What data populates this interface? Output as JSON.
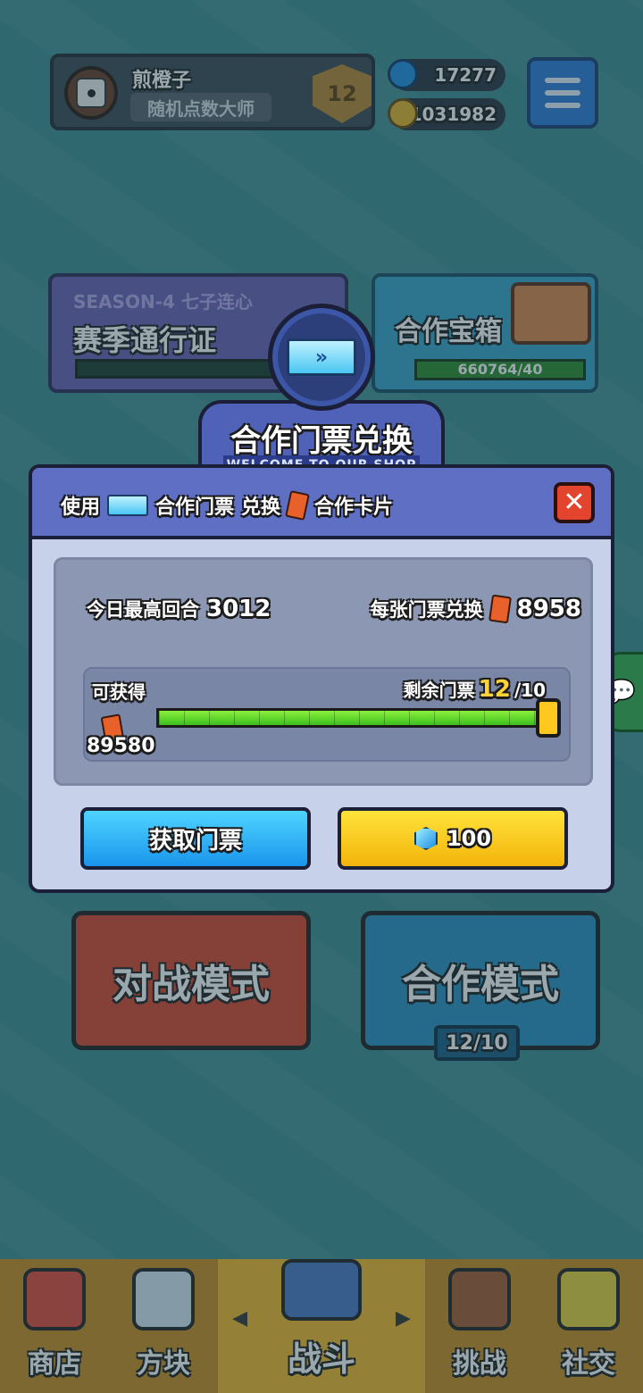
{
  "colors": {
    "background": "#3f8f93",
    "accent_blue": "#1a95ec",
    "accent_yellow": "#f3b40c",
    "progress_green": "#3cbf1e",
    "close_red": "#e2442e"
  },
  "profile": {
    "name": "煎橙子",
    "title": "随机点数大师",
    "rank": "12",
    "avatar_icon": "die-icon"
  },
  "currency": {
    "gems": "17277",
    "coins": "11031982",
    "gem_icon": "gem-icon",
    "coin_icon": "coin-icon"
  },
  "season": {
    "label": "SEASON-4 七子连心",
    "title": "赛季通行证"
  },
  "coop_chest": {
    "title": "合作宝箱",
    "progress_text": "660764/40"
  },
  "modes": {
    "battle": "对战模式",
    "coop": "合作模式",
    "coop_count": "12/10"
  },
  "nav": {
    "items": [
      {
        "label": "商店",
        "icon": "shop-icon"
      },
      {
        "label": "方块",
        "icon": "cube-icon"
      },
      {
        "label": "战斗",
        "icon": "battle-icon"
      },
      {
        "label": "挑战",
        "icon": "challenge-icon"
      },
      {
        "label": "社交",
        "icon": "social-icon"
      }
    ],
    "left_arrow": "◀",
    "right_arrow": "▶"
  },
  "modal": {
    "title": "合作门票兑换",
    "subtitle": "WELCOME TO OUR SHOP",
    "header_use": "使用",
    "header_ticket": "合作门票",
    "header_exchange": "兑换",
    "header_card": "合作卡片",
    "close_label": "✕",
    "today_best_label": "今日最高回合",
    "today_best_value": "3012",
    "per_ticket_label": "每张门票兑换",
    "per_ticket_value": "8958",
    "obtain_label": "可获得",
    "obtain_value": "89580",
    "remaining_label": "剩余门票",
    "remaining_current": "12",
    "remaining_total": "/10",
    "progress_fraction": 1.0,
    "get_ticket_label": "获取门票",
    "buy_price": "100"
  }
}
